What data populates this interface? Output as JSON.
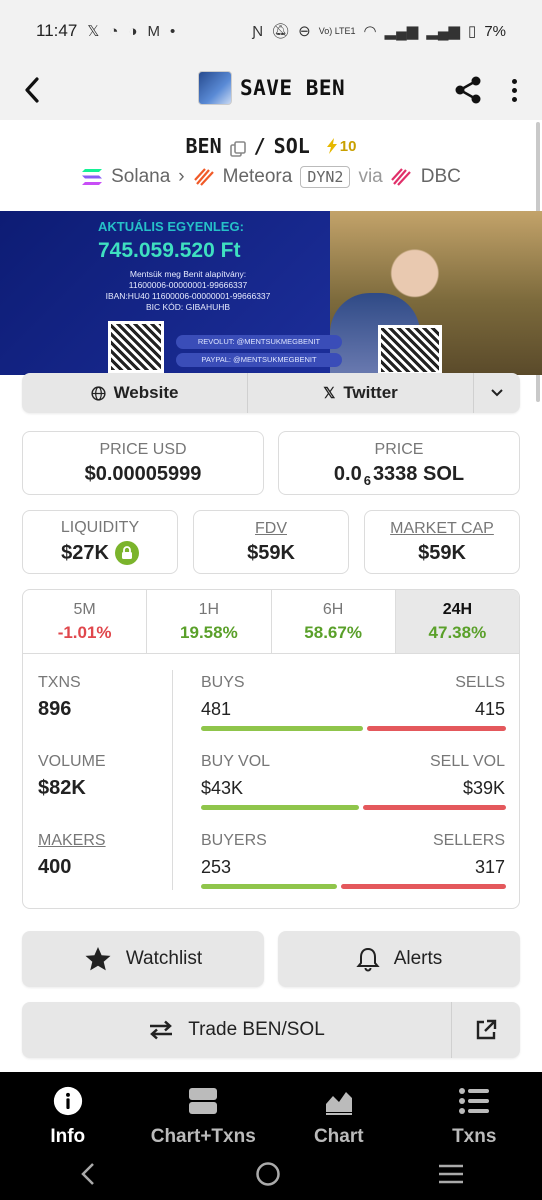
{
  "status_bar": {
    "time": "11:47",
    "battery": "7%",
    "network": "Vo) LTE1"
  },
  "app_bar": {
    "title": "SAVE BEN"
  },
  "pair": {
    "base": "BEN",
    "separator": "/",
    "quote": "SOL",
    "boost": "10"
  },
  "chain": {
    "name": "Solana",
    "dex": "Meteora",
    "dex_badge": "DYN2",
    "via": "via",
    "router": "DBC"
  },
  "banner": {
    "heading": "AKTUÁLIS EGYENLEG:",
    "amount": "745.059.520 Ft",
    "lines": [
      "Mentsük meg Benit alapítvány:",
      "11600006-00000001-99666337",
      "IBAN:HU40 11600006-00000001-99666337",
      "BIC KÓD: GIBAHUHB"
    ],
    "revolut": "REVOLUT: @MENTSUKMEGBENIT",
    "paypal": "PAYPAL: @MENTSUKMEGBENIT"
  },
  "links": {
    "website": "Website",
    "twitter": "Twitter"
  },
  "price": {
    "usd_label": "PRICE USD",
    "usd_value": "$0.00005999",
    "native_label": "PRICE",
    "native_prefix": "0.0",
    "native_sub": "6",
    "native_rest": "3338 SOL"
  },
  "metrics": {
    "liquidity_label": "LIQUIDITY",
    "liquidity_value": "$27K",
    "fdv_label": "FDV",
    "fdv_value": "$59K",
    "mcap_label": "MARKET CAP",
    "mcap_value": "$59K"
  },
  "timeframes": [
    {
      "label": "5M",
      "value": "-1.01%"
    },
    {
      "label": "1H",
      "value": "19.58%"
    },
    {
      "label": "6H",
      "value": "58.67%"
    },
    {
      "label": "24H",
      "value": "47.38%"
    }
  ],
  "stats": {
    "txns_label": "TXNS",
    "txns_value": "896",
    "volume_label": "VOLUME",
    "volume_value": "$82K",
    "makers_label": "MAKERS",
    "makers_value": "400",
    "buys_label": "BUYS",
    "buys_value": "481",
    "sells_label": "SELLS",
    "sells_value": "415",
    "buy_vol_label": "BUY VOL",
    "buy_vol_value": "$43K",
    "sell_vol_label": "SELL VOL",
    "sell_vol_value": "$39K",
    "buyers_label": "BUYERS",
    "buyers_value": "253",
    "sellers_label": "SELLERS",
    "sellers_value": "317"
  },
  "actions": {
    "watchlist": "Watchlist",
    "alerts": "Alerts",
    "trade": "Trade BEN/SOL"
  },
  "bottom_nav": [
    "Info",
    "Chart+Txns",
    "Chart",
    "Txns"
  ],
  "colors": {
    "positive": "#5aa02a",
    "negative": "#e0474c",
    "buy_bar": "#8fc54b",
    "sell_bar": "#e4585c"
  }
}
